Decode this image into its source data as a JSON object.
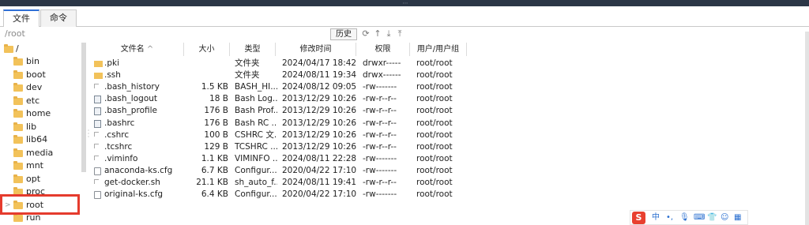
{
  "tabs": [
    {
      "label": "文件"
    },
    {
      "label": "命令"
    }
  ],
  "path": {
    "value": "/root"
  },
  "toolbar": {
    "history_label": "历史"
  },
  "tree": {
    "root_label": "/",
    "items": [
      {
        "label": "bin"
      },
      {
        "label": "boot"
      },
      {
        "label": "dev"
      },
      {
        "label": "etc"
      },
      {
        "label": "home"
      },
      {
        "label": "lib"
      },
      {
        "label": "lib64"
      },
      {
        "label": "media"
      },
      {
        "label": "mnt"
      },
      {
        "label": "opt"
      },
      {
        "label": "proc"
      },
      {
        "label": "root"
      },
      {
        "label": "run"
      }
    ],
    "selected": "root"
  },
  "columns": {
    "name": "文件名",
    "size": "大小",
    "type": "类型",
    "mtime": "修改时间",
    "perm": "权限",
    "owner": "用户/用户组"
  },
  "files": [
    {
      "icon": "folder-icon",
      "name": ".pki",
      "size": "",
      "type": "文件夹",
      "mtime": "2024/04/17 18:42",
      "perm": "drwxr-----",
      "owner": "root/root"
    },
    {
      "icon": "folder-icon",
      "name": ".ssh",
      "size": "",
      "type": "文件夹",
      "mtime": "2024/08/11 19:34",
      "perm": "drwx------",
      "owner": "root/root"
    },
    {
      "icon": "text-file-icon",
      "name": ".bash_history",
      "size": "1.5 KB",
      "type": "BASH_HI...",
      "mtime": "2024/08/12 09:05",
      "perm": "-rw-------",
      "owner": "root/root"
    },
    {
      "icon": "script-file-icon",
      "name": ".bash_logout",
      "size": "18 B",
      "type": "Bash Log...",
      "mtime": "2013/12/29 10:26",
      "perm": "-rw-r--r--",
      "owner": "root/root"
    },
    {
      "icon": "script-file-icon",
      "name": ".bash_profile",
      "size": "176 B",
      "type": "Bash Prof...",
      "mtime": "2013/12/29 10:26",
      "perm": "-rw-r--r--",
      "owner": "root/root"
    },
    {
      "icon": "script-file-icon",
      "name": ".bashrc",
      "size": "176 B",
      "type": "Bash RC ...",
      "mtime": "2013/12/29 10:26",
      "perm": "-rw-r--r--",
      "owner": "root/root"
    },
    {
      "icon": "text-file-icon",
      "name": ".cshrc",
      "size": "100 B",
      "type": "CSHRC 文...",
      "mtime": "2013/12/29 10:26",
      "perm": "-rw-r--r--",
      "owner": "root/root"
    },
    {
      "icon": "text-file-icon",
      "name": ".tcshrc",
      "size": "129 B",
      "type": "TCSHRC ...",
      "mtime": "2013/12/29 10:26",
      "perm": "-rw-r--r--",
      "owner": "root/root"
    },
    {
      "icon": "text-file-icon",
      "name": ".viminfo",
      "size": "1.1 KB",
      "type": "VIMINFO ...",
      "mtime": "2024/08/11 22:28",
      "perm": "-rw-------",
      "owner": "root/root"
    },
    {
      "icon": "config-file-icon",
      "name": "anaconda-ks.cfg",
      "size": "6.7 KB",
      "type": "Configur...",
      "mtime": "2020/04/22 17:10",
      "perm": "-rw-------",
      "owner": "root/root"
    },
    {
      "icon": "text-file-icon",
      "name": "get-docker.sh",
      "size": "21.1 KB",
      "type": "sh_auto_f...",
      "mtime": "2024/08/11 19:41",
      "perm": "-rw-r--r--",
      "owner": "root/root"
    },
    {
      "icon": "config-file-icon",
      "name": "original-ks.cfg",
      "size": "6.4 KB",
      "type": "Configur...",
      "mtime": "2020/04/22 17:10",
      "perm": "-rw-------",
      "owner": "root/root"
    }
  ],
  "ime": {
    "lang": "中"
  },
  "colors": {
    "accent": "#2f6fd6",
    "highlight": "#e53b2d",
    "folder": "#f2c25a"
  }
}
